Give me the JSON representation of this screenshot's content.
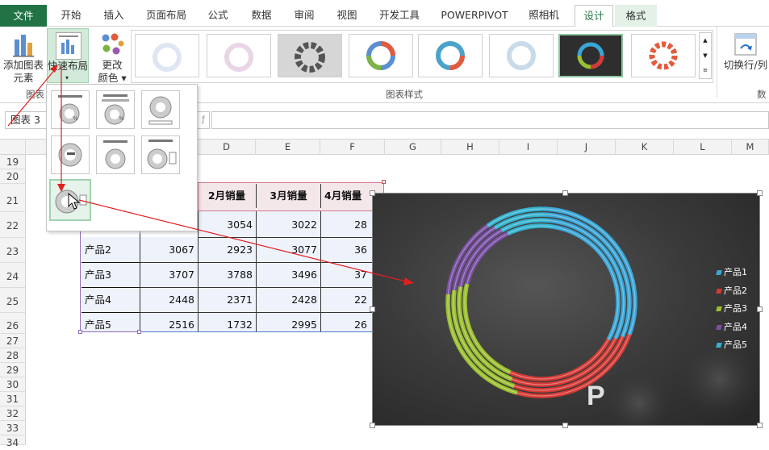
{
  "tabs": [
    "文件",
    "开始",
    "插入",
    "页面布局",
    "公式",
    "数据",
    "审阅",
    "视图",
    "开发工具",
    "POWERPIVOT",
    "照相机",
    "设计",
    "格式"
  ],
  "ribbon": {
    "add_element_line1": "添加图表",
    "add_element_line2": "元素",
    "quick_layout": "快速布局",
    "change_colors_line1": "更改",
    "change_colors_line2": "颜色",
    "group_layouts_label": "图表",
    "group_styles_label": "图表样式",
    "switch_row_col": "切换行/列",
    "group_data_label": "数"
  },
  "formula_bar": {
    "name_box": "图表 3",
    "formula": ""
  },
  "columns": [
    "D",
    "E",
    "F",
    "G",
    "H",
    "I",
    "J",
    "K",
    "L",
    "M"
  ],
  "rows": [
    "19",
    "20",
    "21",
    "22",
    "23",
    "24",
    "25",
    "26",
    "27",
    "28",
    "29",
    "30",
    "31",
    "32",
    "33",
    "34"
  ],
  "table": {
    "headers": [
      "2月销量",
      "3月销量",
      "4月销量"
    ],
    "rows": [
      {
        "label": "",
        "b": "",
        "c": "3054",
        "d": "3022",
        "e": "28"
      },
      {
        "label": "产品2",
        "b": "3067",
        "c": "2923",
        "d": "3077",
        "e": "36"
      },
      {
        "label": "产品3",
        "b": "3707",
        "c": "3788",
        "d": "3496",
        "e": "37"
      },
      {
        "label": "产品4",
        "b": "2448",
        "c": "2371",
        "d": "2428",
        "e": "22"
      },
      {
        "label": "产品5",
        "b": "2516",
        "c": "1732",
        "d": "2995",
        "e": "26"
      }
    ]
  },
  "chart": {
    "legend": [
      "产品1",
      "产品2",
      "产品3",
      "产品4",
      "产品5"
    ],
    "colors": [
      "#3aa6d8",
      "#d63a35",
      "#9bbf2e",
      "#7a4fa5",
      "#35b3d0"
    ],
    "watermark": "P"
  }
}
